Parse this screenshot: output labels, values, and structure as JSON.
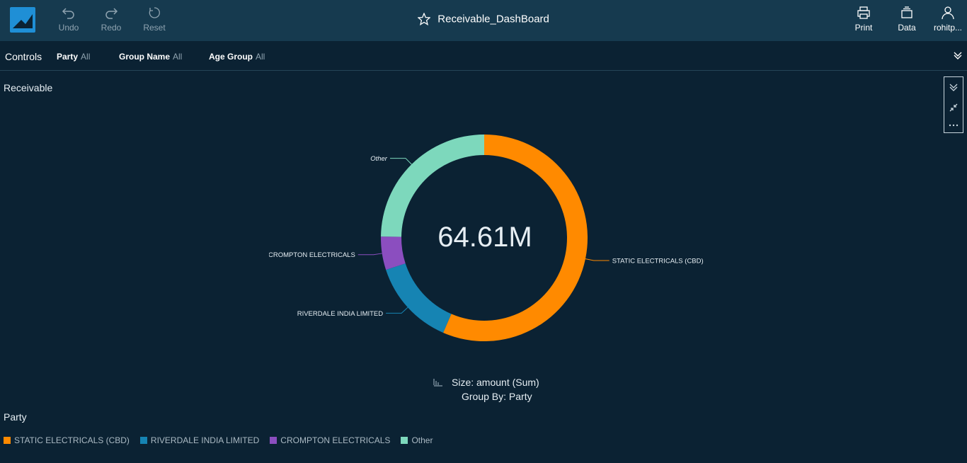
{
  "toolbar": {
    "undo_label": "Undo",
    "redo_label": "Redo",
    "reset_label": "Reset",
    "print_label": "Print",
    "data_label": "Data",
    "user_label": "rohitp..."
  },
  "dashboard": {
    "title": "Receivable_DashBoard"
  },
  "controls": {
    "label": "Controls",
    "items": [
      {
        "name": "Party",
        "value": "All"
      },
      {
        "name": "Group Name",
        "value": "All"
      },
      {
        "name": "Age Group",
        "value": "All"
      }
    ]
  },
  "visual": {
    "title": "Receivable",
    "center_value": "64.61M",
    "size_label": "Size: amount (Sum)",
    "group_label": "Group By: Party",
    "legend_title": "Party"
  },
  "chart_data": {
    "type": "pie",
    "categories": [
      "STATIC ELECTRICALS (CBD)",
      "RIVERDALE INDIA LIMITED",
      "CROMPTON ELECTRICALS",
      "Other"
    ],
    "values": [
      56.5,
      13.5,
      5.2,
      24.8
    ],
    "colors": [
      "#ff8a00",
      "#1684b3",
      "#8b4ebf",
      "#7dd8bc"
    ],
    "center_label": "64.61M",
    "legend_position": "bottom-left"
  },
  "colors": {
    "background": "#0b2233",
    "header": "#163a4f",
    "accent": "#1f8fd6"
  }
}
